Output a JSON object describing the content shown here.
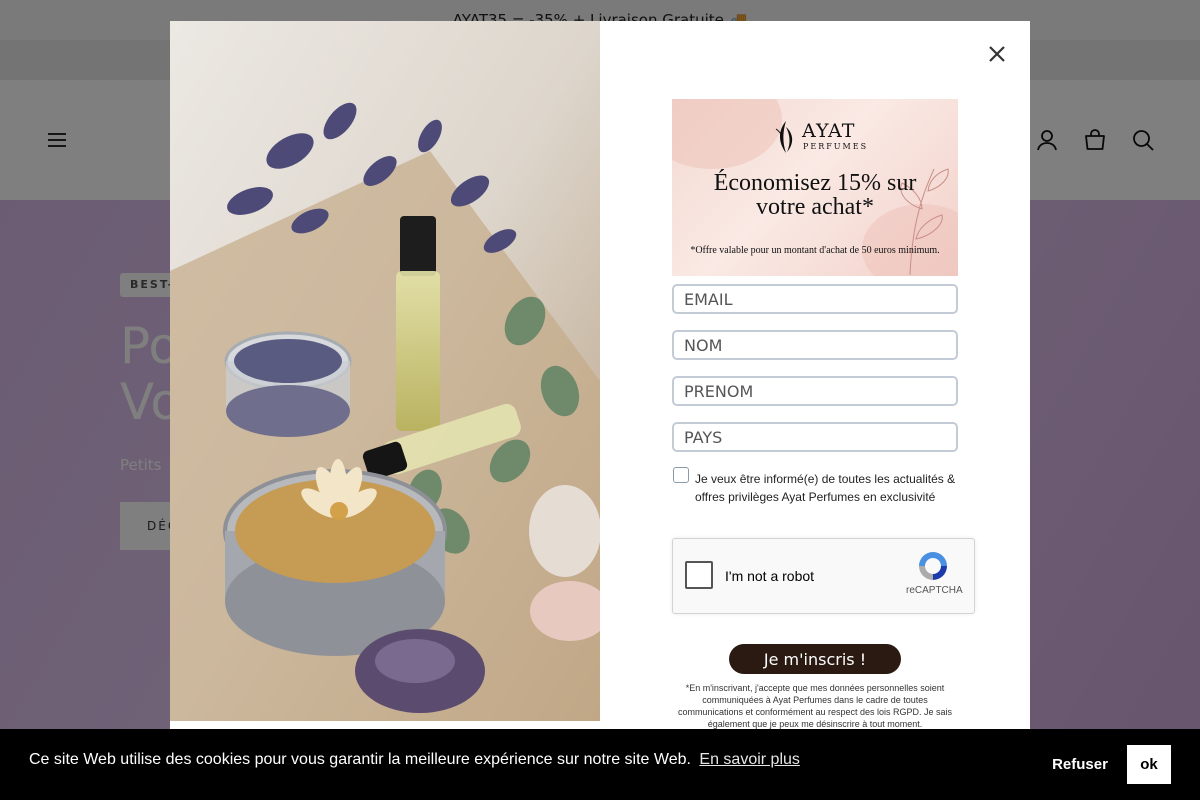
{
  "announcement": {
    "text": "AYAT35 = -35% + Livraison Gratuite 🚚"
  },
  "header": {
    "menu_icon": "hamburger-icon",
    "account_icon": "user-icon",
    "cart_icon": "bag-icon",
    "search_icon": "search-icon"
  },
  "hero": {
    "badge": "BEST-",
    "title_line1": "Po",
    "title_line2": "Vo",
    "subtitle": "Petits",
    "button": "DÉC"
  },
  "popup": {
    "close_icon": "close-icon",
    "banner": {
      "brand_name": "AYAT",
      "brand_sub": "PERFUMES",
      "headline_line1": "Économisez 15% sur",
      "headline_line2": "votre achat*",
      "note": "*Offre valable pour un montant d'achat de 50 euros minimum."
    },
    "fields": {
      "email": "EMAIL",
      "nom": "NOM",
      "prenom": "PRENOM",
      "pays": "PAYS"
    },
    "optin_text": "Je veux être informé(e) de toutes les actualités & offres privilèges Ayat Perfumes en exclusivité",
    "recaptcha": {
      "label": "I'm not a robot",
      "brand": "reCAPTCHA"
    },
    "submit": "Je m'inscris !",
    "legal": "*En m'inscrivant, j'accepte que mes données personnelles soient communiquées à Ayat Perfumes dans le cadre de toutes communications et conformément au respect des lois RGPD. Je sais également que je peux me désinscrire à tout moment."
  },
  "cookie": {
    "text": "Ce site Web utilise des cookies pour vous garantir la meilleure expérience sur notre site Web.",
    "link": "En savoir plus",
    "refuse": "Refuser",
    "ok": "ok"
  },
  "colors": {
    "submit_bg": "#2b1a11",
    "hero_bg": "#d7b9e8",
    "cookie_bg": "#000000"
  }
}
